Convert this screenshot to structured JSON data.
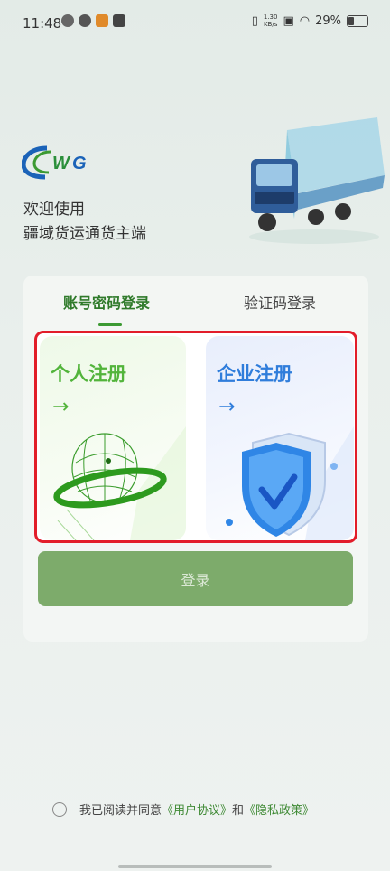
{
  "status_bar": {
    "time": "11:48",
    "net_speed": "1.30\nKB/s",
    "battery": "29%"
  },
  "welcome": {
    "line1": "欢迎使用",
    "line2": "疆域货运通货主端"
  },
  "tabs": [
    {
      "label": "账号密码登录"
    },
    {
      "label": "验证码登录"
    }
  ],
  "register": {
    "personal": {
      "title": "个人注册",
      "arrow": "→"
    },
    "enterprise": {
      "title": "企业注册",
      "arrow": "→"
    }
  },
  "login_button": "登录",
  "agreement": {
    "prefix": "我已阅读并同意",
    "user_agreement": "《用户协议》",
    "and": "和",
    "privacy_policy": "《隐私政策》"
  },
  "colors": {
    "accent_green": "#3c9a32",
    "accent_blue": "#2f7ddb",
    "highlight_red": "#e21d2a"
  }
}
